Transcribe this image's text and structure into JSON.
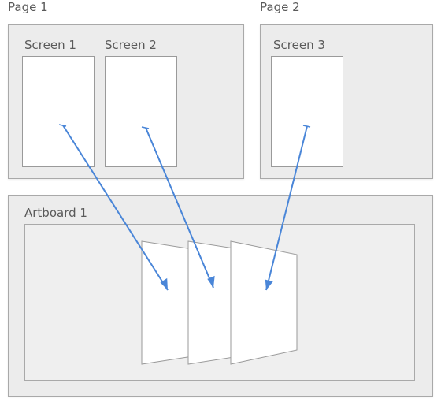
{
  "pages": [
    {
      "label": "Page 1",
      "screens": [
        {
          "label": "Screen 1"
        },
        {
          "label": "Screen 2"
        }
      ]
    },
    {
      "label": "Page 2",
      "screens": [
        {
          "label": "Screen 3"
        }
      ]
    }
  ],
  "artboard": {
    "label": "Artboard 1"
  },
  "colors": {
    "link": "#4a86d8",
    "frame_bg": "#ececec",
    "frame_border": "#a9a9a9",
    "screen_bg": "#ffffff"
  }
}
